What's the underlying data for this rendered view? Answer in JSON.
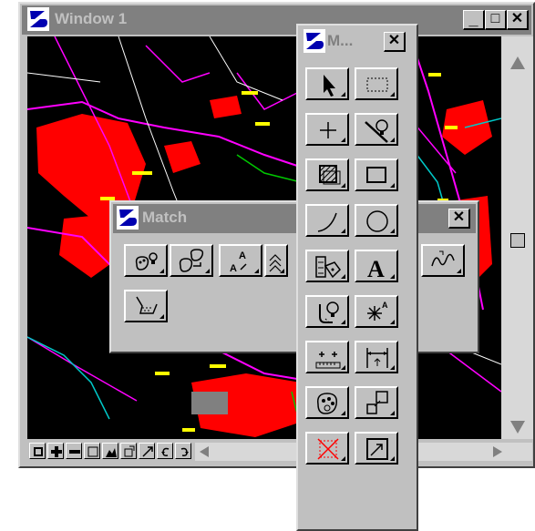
{
  "window1": {
    "title": "Window 1",
    "caption_buttons": {
      "minimize": "_",
      "maximize": "□",
      "close": "✕"
    },
    "view_controls": [
      "update-view-icon",
      "zoom-in-icon",
      "zoom-out-icon",
      "window-area-icon",
      "fit-view-icon",
      "rotate-view-icon",
      "pan-view-icon",
      "view-previous-icon",
      "view-next-icon"
    ]
  },
  "main_palette": {
    "title": "M...",
    "close": "✕",
    "tools": [
      "element-selection-icon",
      "fence-icon",
      "data-point-icon",
      "lightbulb-line-icon",
      "patterning-icon",
      "rectangle-icon",
      "arc-icon",
      "circle-icon",
      "cell-tag-icon",
      "text-icon",
      "settings-lightbulb-icon",
      "cell-star-icon",
      "measure-icon",
      "dimension-icon",
      "element-attributes-icon",
      "copy-element-icon",
      "delete-element-icon",
      "fit-view-icon"
    ]
  },
  "match_palette": {
    "title": "Match",
    "close": "✕",
    "tools": [
      "match-element-attributes-icon",
      "change-element-attributes-icon",
      "match-text-attributes-icon",
      "match-multiline-icon",
      "match-curve-icon",
      "match-pattern-icon"
    ]
  },
  "colors": {
    "titlebar_inactive": "#808080",
    "face": "#c0c0c0",
    "map_bg": "#000000",
    "map_red": "#ff0000",
    "map_magenta": "#ff00ff",
    "map_yellow": "#ffff00",
    "map_cyan": "#00c8c8",
    "map_green": "#00c800"
  }
}
